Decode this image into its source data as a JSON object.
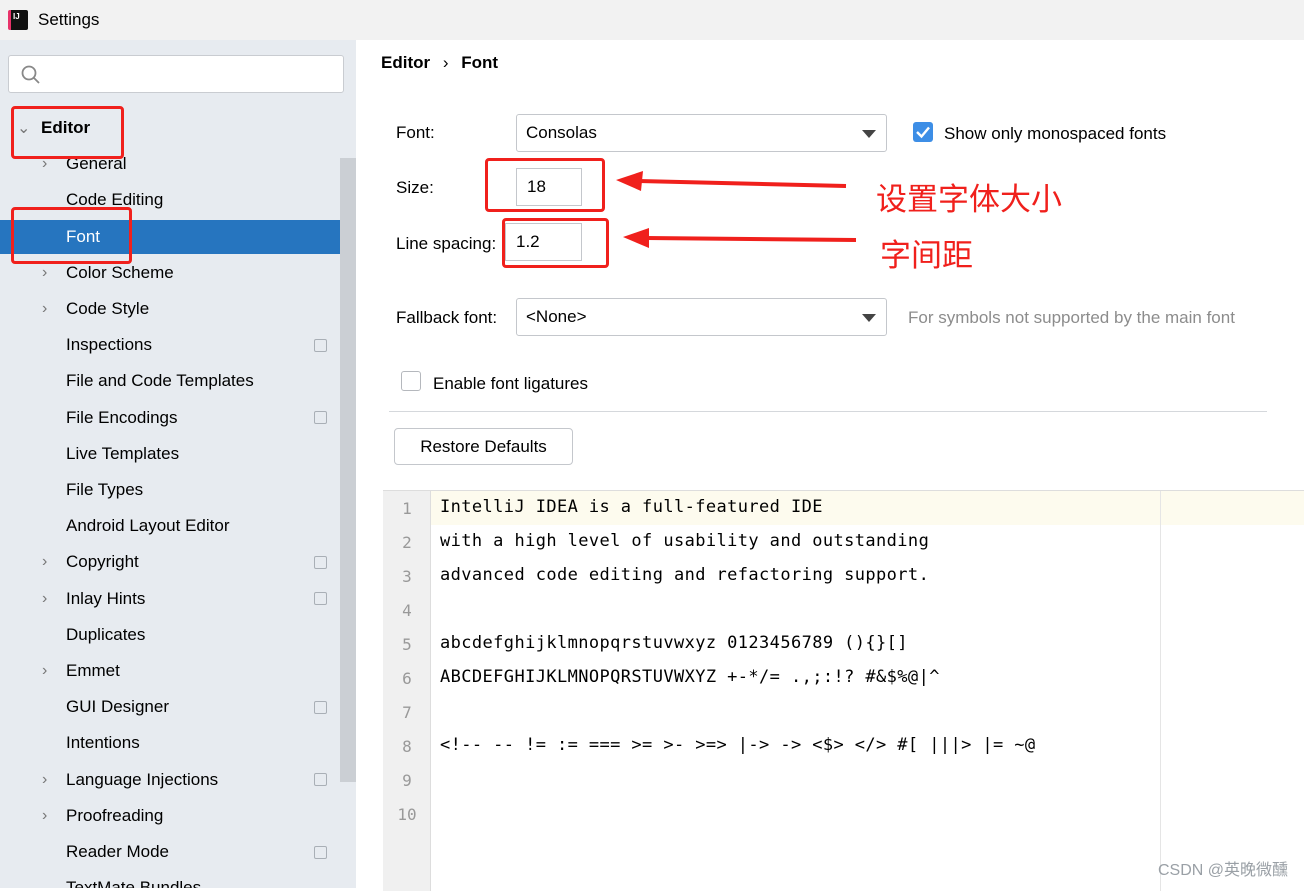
{
  "window": {
    "title": "Settings"
  },
  "sidebar": {
    "search_placeholder": "",
    "items": [
      {
        "label": "Editor",
        "expanded": true
      },
      {
        "label": "General",
        "chevron": true
      },
      {
        "label": "Code Editing"
      },
      {
        "label": "Font",
        "selected": true
      },
      {
        "label": "Color Scheme",
        "chevron": true
      },
      {
        "label": "Code Style",
        "chevron": true
      },
      {
        "label": "Inspections",
        "copy": true
      },
      {
        "label": "File and Code Templates"
      },
      {
        "label": "File Encodings",
        "copy": true
      },
      {
        "label": "Live Templates"
      },
      {
        "label": "File Types"
      },
      {
        "label": "Android Layout Editor"
      },
      {
        "label": "Copyright",
        "chevron": true,
        "copy": true
      },
      {
        "label": "Inlay Hints",
        "chevron": true,
        "copy": true
      },
      {
        "label": "Duplicates"
      },
      {
        "label": "Emmet",
        "chevron": true
      },
      {
        "label": "GUI Designer",
        "copy": true
      },
      {
        "label": "Intentions"
      },
      {
        "label": "Language Injections",
        "chevron": true,
        "copy": true
      },
      {
        "label": "Proofreading",
        "chevron": true
      },
      {
        "label": "Reader Mode",
        "copy": true
      },
      {
        "label": "TextMate Bundles"
      }
    ]
  },
  "breadcrumb": {
    "parent": "Editor",
    "sep": "›",
    "current": "Font"
  },
  "form": {
    "font_label": "Font:",
    "font_value": "Consolas",
    "mono_label": "Show only monospaced fonts",
    "mono_checked": true,
    "size_label": "Size:",
    "size_value": "18",
    "spacing_label": "Line spacing:",
    "spacing_value": "1.2",
    "fallback_label": "Fallback font:",
    "fallback_value": "<None>",
    "fallback_hint": "For symbols not supported by the main font",
    "ligatures_label": "Enable font ligatures",
    "ligatures_checked": false,
    "restore_label": "Restore Defaults"
  },
  "preview": {
    "lines": [
      "IntelliJ IDEA is a full-featured IDE",
      "with a high level of usability and outstanding",
      "advanced code editing and refactoring support.",
      "",
      "abcdefghijklmnopqrstuvwxyz 0123456789 (){}[]",
      "ABCDEFGHIJKLMNOPQRSTUVWXYZ +-*/= .,;:!? #&$%@|^",
      "",
      "<!-- -- != := === >= >- >=> |-> -> <$> </> #[ |||> |= ~@",
      "",
      ""
    ]
  },
  "annotations": {
    "size_note": "设置字体大小",
    "spacing_note": "字间距",
    "color": "#f0201c"
  },
  "watermark": "CSDN @英晚微醺",
  "colors": {
    "accent": "#2675bf",
    "checkbox": "#3d8ee6"
  }
}
